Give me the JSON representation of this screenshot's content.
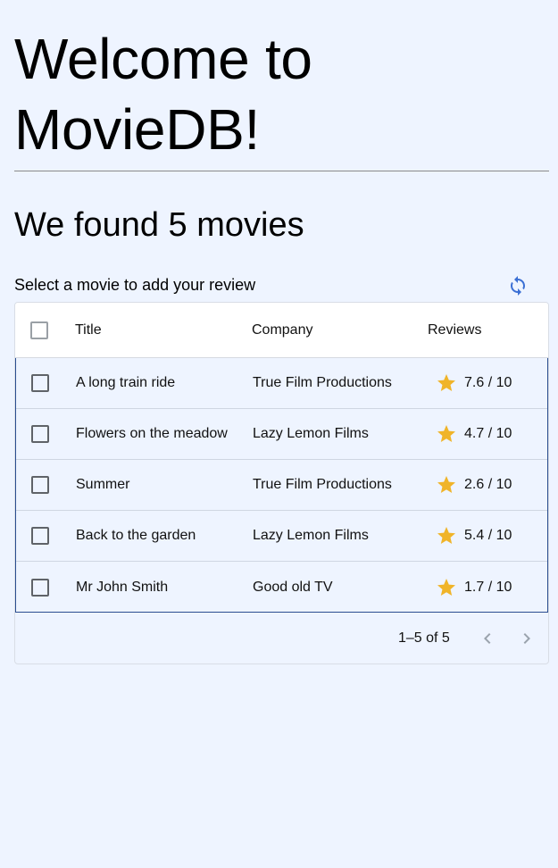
{
  "header": {
    "title": "Welcome to MovieDB!",
    "count_heading": "We found 5 movies",
    "subtitle": "Select a movie to add your review",
    "refresh_icon": "refresh-icon"
  },
  "table": {
    "columns": {
      "title": "Title",
      "company": "Company",
      "reviews": "Reviews"
    },
    "rows": [
      {
        "title": "A long train ride",
        "company": "True Film Productions",
        "rating": "7.6 / 10"
      },
      {
        "title": "Flowers on the meadow",
        "company": "Lazy Lemon Films",
        "rating": "4.7 / 10"
      },
      {
        "title": "Summer",
        "company": "True Film Productions",
        "rating": "2.6 / 10"
      },
      {
        "title": "Back to the garden",
        "company": "Lazy Lemon Films",
        "rating": "5.4 / 10"
      },
      {
        "title": "Mr John Smith",
        "company": "Good old TV",
        "rating": "1.7 / 10"
      }
    ],
    "pagination": {
      "label": "1–5 of 5",
      "prev_icon": "chevron-left-icon",
      "next_icon": "chevron-right-icon"
    }
  },
  "colors": {
    "background": "#eef4ff",
    "star": "#f0b429",
    "accent": "#3b6fd4",
    "selected_border": "#2a4d8f"
  }
}
